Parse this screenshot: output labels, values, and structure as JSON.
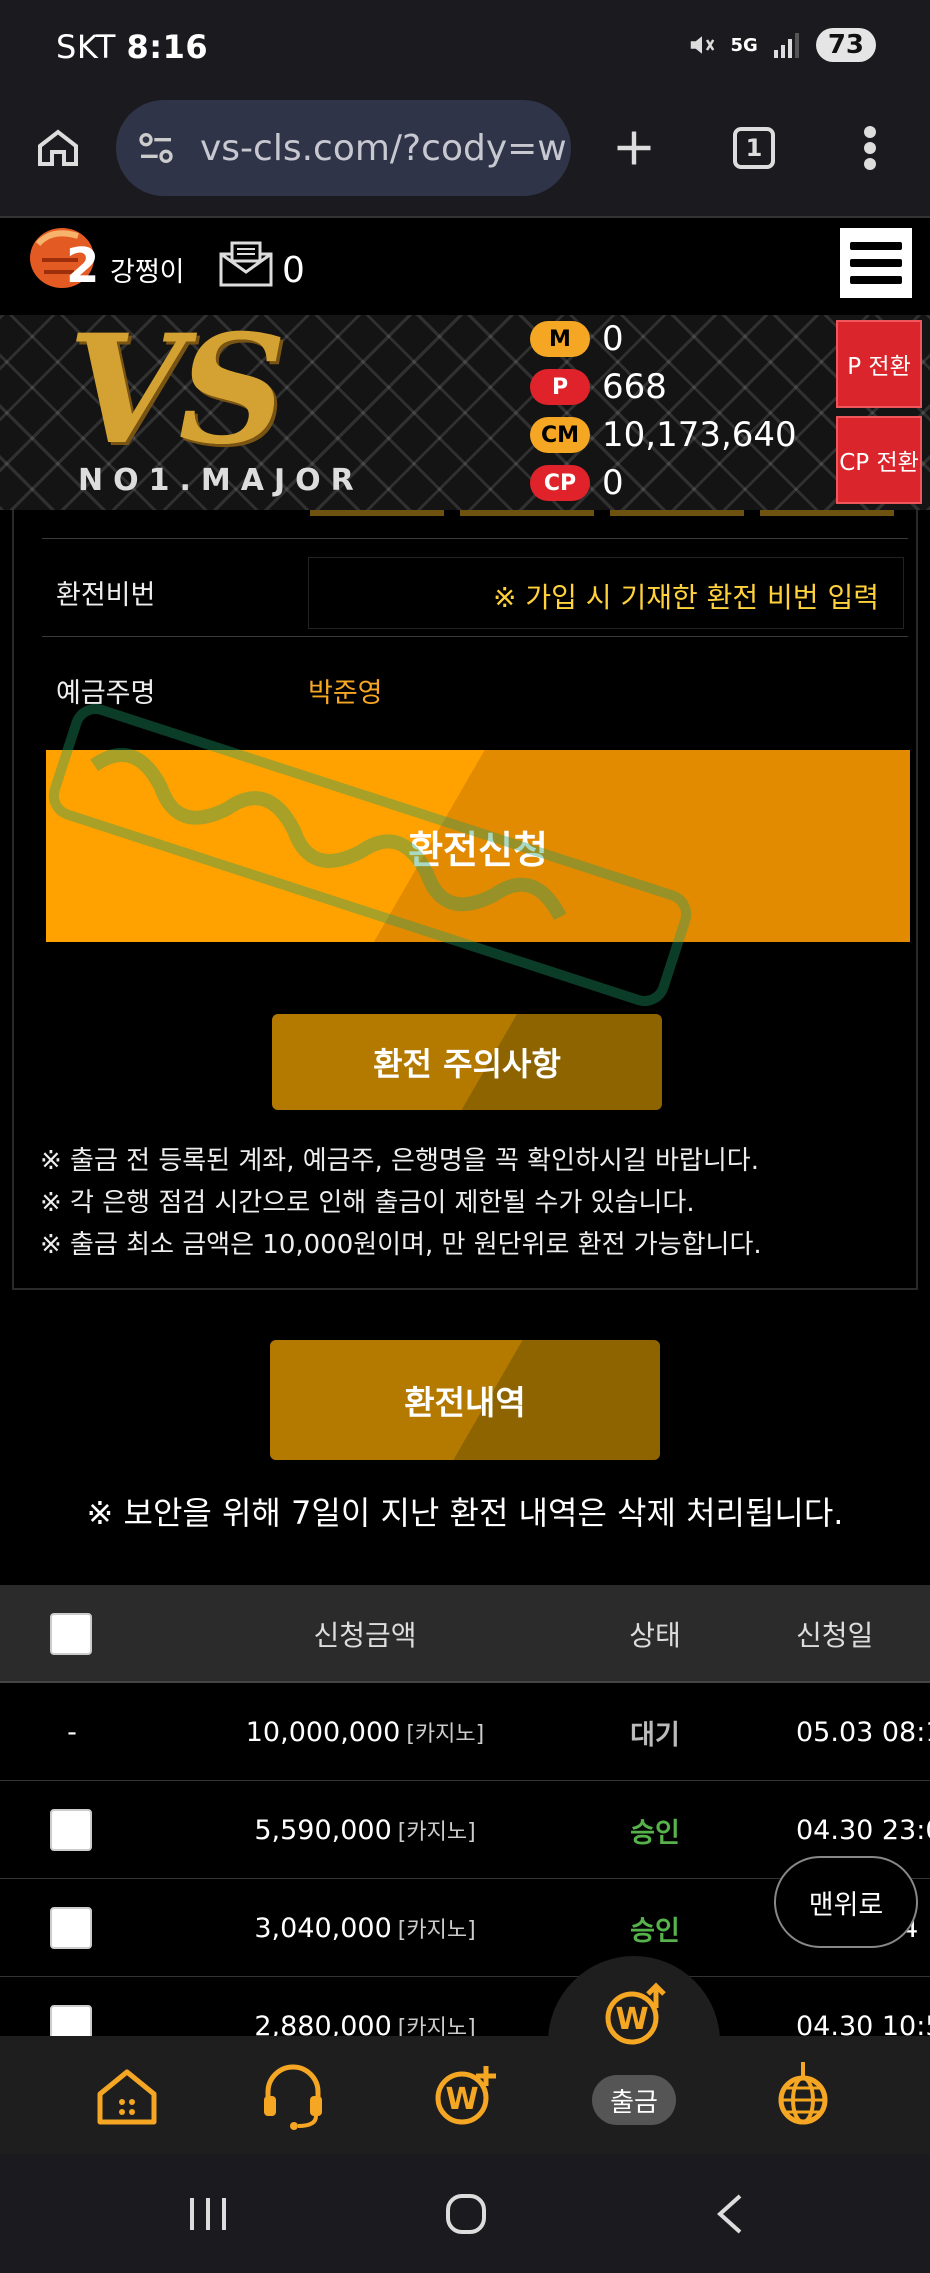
{
  "status_bar": {
    "carrier": "SKT",
    "time": "8:16",
    "network": "5G",
    "battery": "73"
  },
  "browser": {
    "url": "vs-cls.com/?cody=w",
    "tab_count": "1"
  },
  "header": {
    "level": "2",
    "nickname": "강쩡이",
    "mail_count": "0"
  },
  "points": {
    "m": {
      "badge": "M",
      "value": "0",
      "color": "#f5a623"
    },
    "p": {
      "badge": "P",
      "value": "668",
      "color": "#e0232b"
    },
    "cm": {
      "badge": "CM",
      "value": "10,173,640",
      "color": "#f5a623"
    },
    "cp": {
      "badge": "CP",
      "value": "0",
      "color": "#e0232b"
    }
  },
  "convert_buttons": {
    "p": "P 전환",
    "cp": "CP 전환"
  },
  "logo": {
    "main": "VS",
    "sub": "NO1.MAJOR"
  },
  "form": {
    "pin_label": "환전비번",
    "pin_placeholder": "※ 가입 시 기재한 환전 비번 입력",
    "depositor_label": "예금주명",
    "depositor_value": "박준영",
    "apply_button": "환전신청",
    "caution_button": "환전 주의사항"
  },
  "notices": [
    "※ 출금 전 등록된 계좌, 예금주, 은행명을 꼭 확인하시길 바랍니다.",
    "※ 각 은행 점검 시간으로 인해 출금이 제한될 수가 있습니다.",
    "※ 출금 최소 금액은 10,000원이며, 만 원단위로 환전 가능합니다."
  ],
  "history": {
    "button": "환전내역",
    "security_note": "※ 보안을 위해 7일이 지난 환전 내역은 삭제 처리됩니다.",
    "columns": {
      "amount": "신청금액",
      "status": "상태",
      "date": "신청일"
    },
    "rows": [
      {
        "check": "-",
        "amount": "10,000,000",
        "category": "[카지노]",
        "status": "대기",
        "date": "05.03 08:1"
      },
      {
        "check": "",
        "amount": "5,590,000",
        "category": "[카지노]",
        "status": "승인",
        "date": "04.30 23:0"
      },
      {
        "check": "",
        "amount": "3,040,000",
        "category": "[카지노]",
        "status": "승인",
        "date": ":4"
      },
      {
        "check": "",
        "amount": "2,880,000",
        "category": "[카지노]",
        "status": "",
        "date": "04.30 10:5"
      }
    ]
  },
  "scroll_top": "맨위로",
  "bottom_nav": {
    "withdraw_label": "출금"
  },
  "colors": {
    "accent": "#ffa200",
    "approved": "#56b24a",
    "danger": "#d9252b"
  }
}
